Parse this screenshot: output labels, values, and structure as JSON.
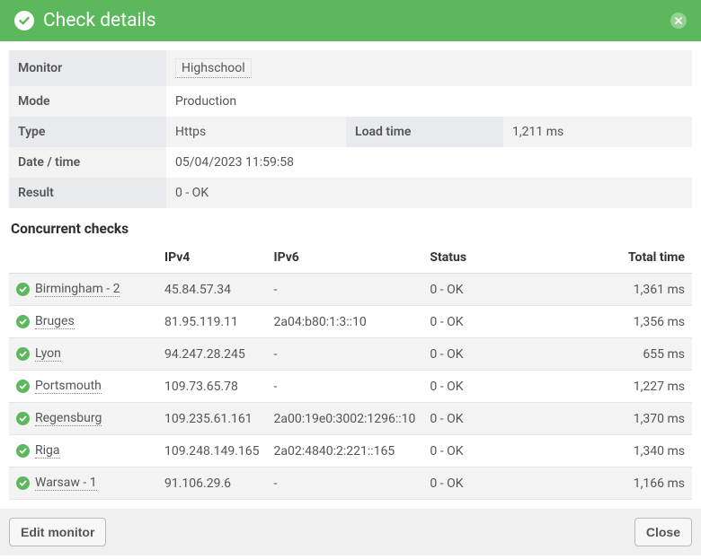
{
  "header": {
    "title": "Check details"
  },
  "info": {
    "monitor_label": "Monitor",
    "monitor_value": "Highschool",
    "mode_label": "Mode",
    "mode_value": "Production",
    "type_label": "Type",
    "type_value": "Https",
    "loadtime_label": "Load time",
    "loadtime_value": "1,211 ms",
    "datetime_label": "Date / time",
    "datetime_value": "05/04/2023 11:59:58",
    "result_label": "Result",
    "result_value": "0 - OK"
  },
  "concurrent": {
    "title": "Concurrent checks",
    "columns": {
      "ipv4": "IPv4",
      "ipv6": "IPv6",
      "status": "Status",
      "total_time": "Total time"
    },
    "rows": [
      {
        "location": "Birmingham - 2",
        "ipv4": "45.84.57.34",
        "ipv6": "-",
        "status": "0 - OK",
        "total_time": "1,361 ms"
      },
      {
        "location": "Bruges",
        "ipv4": "81.95.119.11",
        "ipv6": "2a04:b80:1:3::10",
        "status": "0 - OK",
        "total_time": "1,356 ms"
      },
      {
        "location": "Lyon",
        "ipv4": "94.247.28.245",
        "ipv6": "-",
        "status": "0 - OK",
        "total_time": "655 ms"
      },
      {
        "location": "Portsmouth",
        "ipv4": "109.73.65.78",
        "ipv6": "-",
        "status": "0 - OK",
        "total_time": "1,227 ms"
      },
      {
        "location": "Regensburg",
        "ipv4": "109.235.61.161",
        "ipv6": "2a00:19e0:3002:1296::10",
        "status": "0 - OK",
        "total_time": "1,370 ms"
      },
      {
        "location": "Riga",
        "ipv4": "109.248.149.165",
        "ipv6": "2a02:4840:2:221::165",
        "status": "0 - OK",
        "total_time": "1,340 ms"
      },
      {
        "location": "Warsaw - 1",
        "ipv4": "91.106.29.6",
        "ipv6": "-",
        "status": "0 - OK",
        "total_time": "1,166 ms"
      }
    ]
  },
  "footer": {
    "edit_label": "Edit monitor",
    "close_label": "Close"
  }
}
